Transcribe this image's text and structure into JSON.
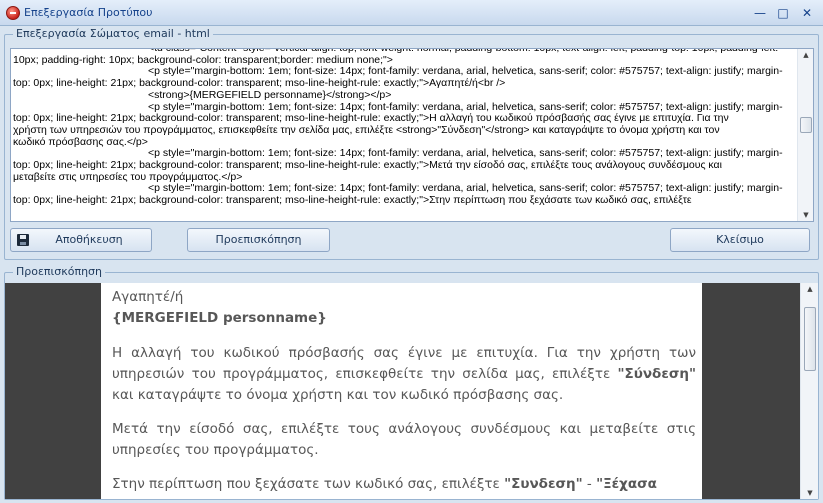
{
  "window": {
    "title": "Επεξεργασία Προτύπου",
    "min_glyph": "—",
    "max_glyph": "□",
    "close_glyph": "✕"
  },
  "editor": {
    "group_title": "Επεξεργασία Σώματος email - html",
    "lines": [
      {
        "indent": true,
        "text": "<td class=\"Content\" style=\"vertical-align: top; font-weight: normal; padding-bottom: 10px; text-align: left; padding-top: 10px; padding-left:"
      },
      {
        "indent": false,
        "text": "10px;  padding-right: 10px; background-color: transparent;border: medium none;\">"
      },
      {
        "indent": true,
        "text": "<p style=\"margin-bottom: 1em; font-size: 14px; font-family: verdana, arial, helvetica, sans-serif; color: #575757; text-align: justify; margin-"
      },
      {
        "indent": false,
        "text": "top: 0px; line-height: 21px; background-color: transparent; mso-line-height-rule: exactly;\">Αγαπητέ/ή<br />"
      },
      {
        "indent": true,
        "text": "<strong>{MERGEFIELD personname}</strong></p>"
      },
      {
        "indent": true,
        "text": "<p style=\"margin-bottom: 1em; font-size: 14px; font-family: verdana, arial, helvetica, sans-serif; color: #575757; text-align: justify; margin-"
      },
      {
        "indent": false,
        "text": "top: 0px; line-height: 21px; background-color: transparent; mso-line-height-rule: exactly;\">Η αλλαγή του κωδικού πρόσβασής σας έγινε με επιτυχία. Για την"
      },
      {
        "indent": false,
        "text": "χρήστη των υπηρεσιών του προγράμματος, επισκεφθείτε την σελίδα μας, επιλέξτε <strong>\"Σύνδεση\"</strong> και καταγράψτε το όνομα χρήστη και τον"
      },
      {
        "indent": false,
        "text": "κωδικό πρόσβασης σας.</p>"
      },
      {
        "indent": true,
        "text": "<p style=\"margin-bottom: 1em; font-size: 14px; font-family: verdana, arial, helvetica, sans-serif; color: #575757; text-align: justify; margin-"
      },
      {
        "indent": false,
        "text": "top: 0px; line-height: 21px; background-color: transparent; mso-line-height-rule: exactly;\">Μετά την είσοδό σας, επιλέξτε τους ανάλογους συνδέσμους και"
      },
      {
        "indent": false,
        "text": "μεταβείτε στις υπηρεσίες του προγράμματος.</p>"
      },
      {
        "indent": true,
        "text": "<p style=\"margin-bottom: 1em; font-size: 14px; font-family: verdana, arial, helvetica, sans-serif; color: #575757; text-align: justify; margin-"
      },
      {
        "indent": false,
        "text": "top: 0px; line-height: 21px; background-color: transparent; mso-line-height-rule: exactly;\">Στην περίπτωση που ξεχάσατε των κωδικό σας, επιλέξτε"
      }
    ]
  },
  "buttons": {
    "save": "Αποθήκευση",
    "preview": "Προεπισκόπηση",
    "close": "Κλείσιμο"
  },
  "splitter_glyph": "......",
  "preview": {
    "group_title": "Προεπισκόπηση",
    "greeting": "Αγαπητέ/ή",
    "merge_field": "{MERGEFIELD personname}",
    "p1_before": "Η αλλαγή του κωδικού πρόσβασής σας έγινε με επιτυχία. Για την χρήστη των υπηρεσιών του προγράμματος, επισκεφθείτε την σελίδα μας, επιλέξτε ",
    "p1_bold": "\"Σύνδεση\"",
    "p1_after": " και καταγράψτε το όνομα χρήστη και τον κωδικό πρόσβασης σας.",
    "p2": "Μετά την είσοδό σας, επιλέξτε τους ανάλογους συνδέσμους και μεταβείτε στις υπηρεσίες του προγράμματος.",
    "p3_before": "Στην περίπτωση που ξεχάσατε των κωδικό σας, επιλέξτε ",
    "p3_bold": "\"Συνδεση\"",
    "p3_dash": " - ",
    "p3_bold2": "\"Ξέχασα"
  },
  "scroll_glyphs": {
    "up": "▲",
    "down": "▼"
  }
}
